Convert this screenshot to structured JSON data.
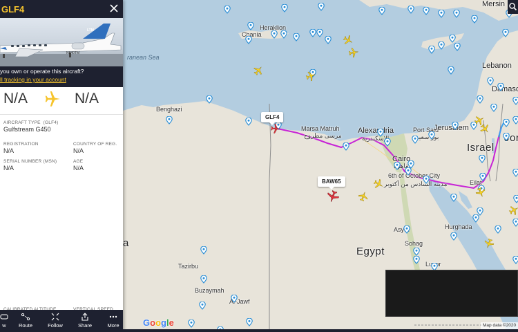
{
  "panel": {
    "title": "GLF4",
    "own_question": "you own or operate this aircraft?",
    "own_link": "ll tracking in your account",
    "photo_reg": "N840TM",
    "route": {
      "origin": "N/A",
      "destination": "N/A"
    },
    "aircraft_type_label": "AIRCRAFT TYPE",
    "aircraft_type_code": "(GLF4)",
    "aircraft_model": "Gulfstream G450",
    "registration_label": "REGISTRATION",
    "registration_value": "N/A",
    "country_label": "COUNTRY OF REG.",
    "country_value": "N/A",
    "serial_label": "SERIAL NUMBER (MSN)",
    "serial_value": "N/A",
    "age_label": "AGE",
    "age_value": "N/A",
    "calibrated_altitude_label": "CALIBRATED ALTITUDE",
    "vertical_speed_label": "VERTICAL SPEED",
    "nav": [
      {
        "label": "w",
        "icon": "view-icon"
      },
      {
        "label": "Route",
        "icon": "route-icon"
      },
      {
        "label": "Follow",
        "icon": "follow-icon"
      },
      {
        "label": "Share",
        "icon": "share-icon"
      },
      {
        "label": "More",
        "icon": "more-icon"
      }
    ]
  },
  "map": {
    "places": {
      "mersin": "Mersin",
      "chania": "Chania",
      "heraklion": "Heraklion",
      "sea": "ranean Sea",
      "lebanon": "Lebanon",
      "damascus": "Damasc",
      "benghazi": "Benghazi",
      "marsa_matruh": "Marsa Matruh",
      "marsa_matruh_ar": "مرسى مطروح",
      "alexandria": "Alexandria",
      "alexandria_ar": "الإسكندرية",
      "port_said": "Port Said",
      "port_said_ar": "بور سعيد",
      "jerusalem": "Jerusalem",
      "israel": "Israel",
      "jordan": "Jor",
      "cairo": "Cairo",
      "cairo_ar": "القاهرة",
      "october_city": "6th of October City",
      "october_city_ar": "مدينة السادس من أكتوبر",
      "eilat": "Eilat",
      "hurghada": "Hurghada",
      "asyut": "Asyut",
      "sohag": "Sohag",
      "luxor": "Luxor",
      "egypt": "Egypt",
      "tazirbu": "Tazirbu",
      "buzaymah": "Buzaymah",
      "al_jawf": "Al-Jawf",
      "libya_edge": "a"
    },
    "flights": {
      "selected": "GLF4",
      "other": "BAW65"
    },
    "attribution": "Map data ©2020",
    "google": [
      "G",
      "o",
      "o",
      "g",
      "l",
      "e"
    ]
  },
  "colors": {
    "panel_dark": "#1e2130",
    "accent_yellow": "#f6c42d",
    "track_magenta": "#c724d6",
    "track_blue": "#3aa0f0",
    "selected_plane": "#e0353f",
    "plane_yellow": "#f8d423",
    "pin_blue": "#2c8fd6"
  }
}
